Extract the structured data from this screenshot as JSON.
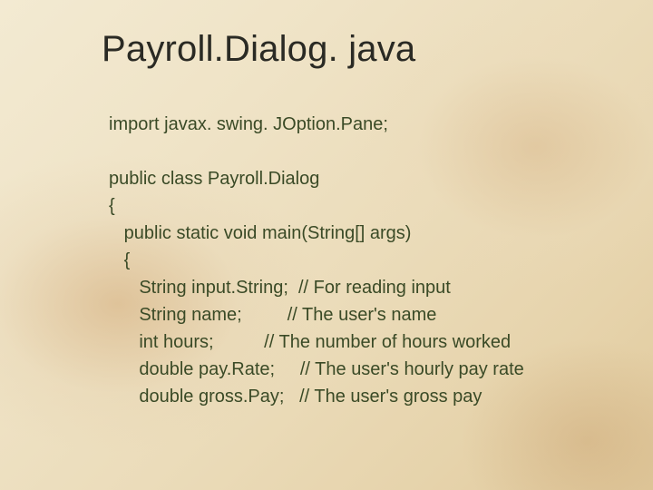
{
  "title": "Payroll.Dialog. java",
  "code": {
    "l1": "import javax. swing. JOption.Pane;",
    "l2": "public class Payroll.Dialog",
    "l3": "{",
    "l4": "   public static void main(String[] args)",
    "l5": "   {",
    "l6": "      String input.String;  // For reading input",
    "l7": "      String name;         // The user's name",
    "l8": "      int hours;          // The number of hours worked",
    "l9": "      double pay.Rate;     // The user's hourly pay rate",
    "l10": "      double gross.Pay;   // The user's gross pay"
  }
}
